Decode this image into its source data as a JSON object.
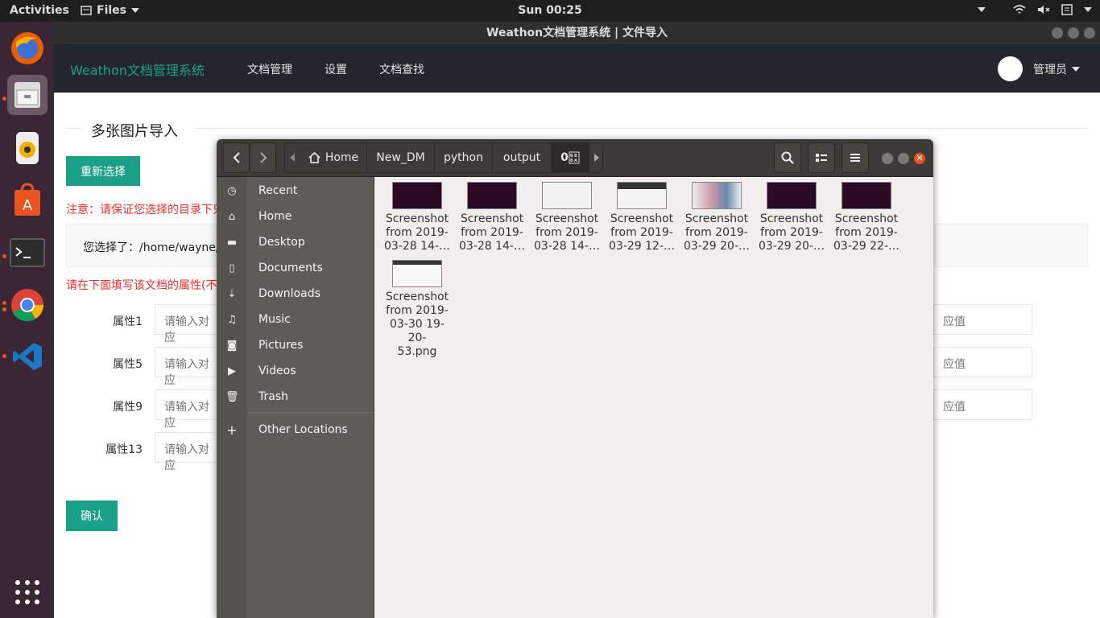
{
  "topbar": {
    "activities": "Activities",
    "app": "Files",
    "clock": "Sun 00:25",
    "tray_icons": [
      "wifi-icon",
      "volume-icon",
      "clipboard-icon",
      "power-icon"
    ]
  },
  "dock": {
    "apps": [
      "firefox",
      "files",
      "rhythmbox",
      "software",
      "terminal",
      "chrome",
      "vscode"
    ],
    "grid_icon": "show-applications-icon"
  },
  "window": {
    "title": "Weathon文档管理系统 | 文件导入"
  },
  "app": {
    "brand": "Weathon文档管理系统",
    "nav": [
      "文档管理",
      "设置",
      "文档查找"
    ],
    "user": "管理员",
    "section_title": "多张图片导入",
    "reselect_label": "重新选择",
    "notice": "注意：请保证您选择的目录下只",
    "selected_text": "您选择了：/home/wayne/P",
    "attr_notice": "请在下面填写该文档的属性(不",
    "placeholder_left": "请输入对应",
    "placeholder_right": "应值",
    "attrs": [
      "属性1",
      "属性5",
      "属性9",
      "属性13"
    ],
    "confirm_label": "确认"
  },
  "filemanager": {
    "breadcrumbs": [
      "Home",
      "New_DM",
      "python",
      "output",
      "0"
    ],
    "sidebar": [
      "Recent",
      "Home",
      "Desktop",
      "Documents",
      "Downloads",
      "Music",
      "Pictures",
      "Videos",
      "Trash",
      "Other Locations"
    ],
    "files": [
      {
        "l1": "Screenshot",
        "l2": "from 2019-",
        "l3": "03-28 14-…",
        "l4": ""
      },
      {
        "l1": "Screenshot",
        "l2": "from 2019-",
        "l3": "03-28 14-…",
        "l4": ""
      },
      {
        "l1": "Screenshot",
        "l2": "from 2019-",
        "l3": "03-28 14-…",
        "l4": ""
      },
      {
        "l1": "Screenshot",
        "l2": "from 2019-",
        "l3": "03-29 12-…",
        "l4": ""
      },
      {
        "l1": "Screenshot",
        "l2": "from 2019-",
        "l3": "03-29 20-…",
        "l4": ""
      },
      {
        "l1": "Screenshot",
        "l2": "from 2019-",
        "l3": "03-29 20-…",
        "l4": ""
      },
      {
        "l1": "Screenshot",
        "l2": "from 2019-",
        "l3": "03-29 22-…",
        "l4": ""
      },
      {
        "l1": "Screenshot",
        "l2": "from 2019-",
        "l3": "03-30 19-20-",
        "l4": "53.png"
      }
    ]
  }
}
